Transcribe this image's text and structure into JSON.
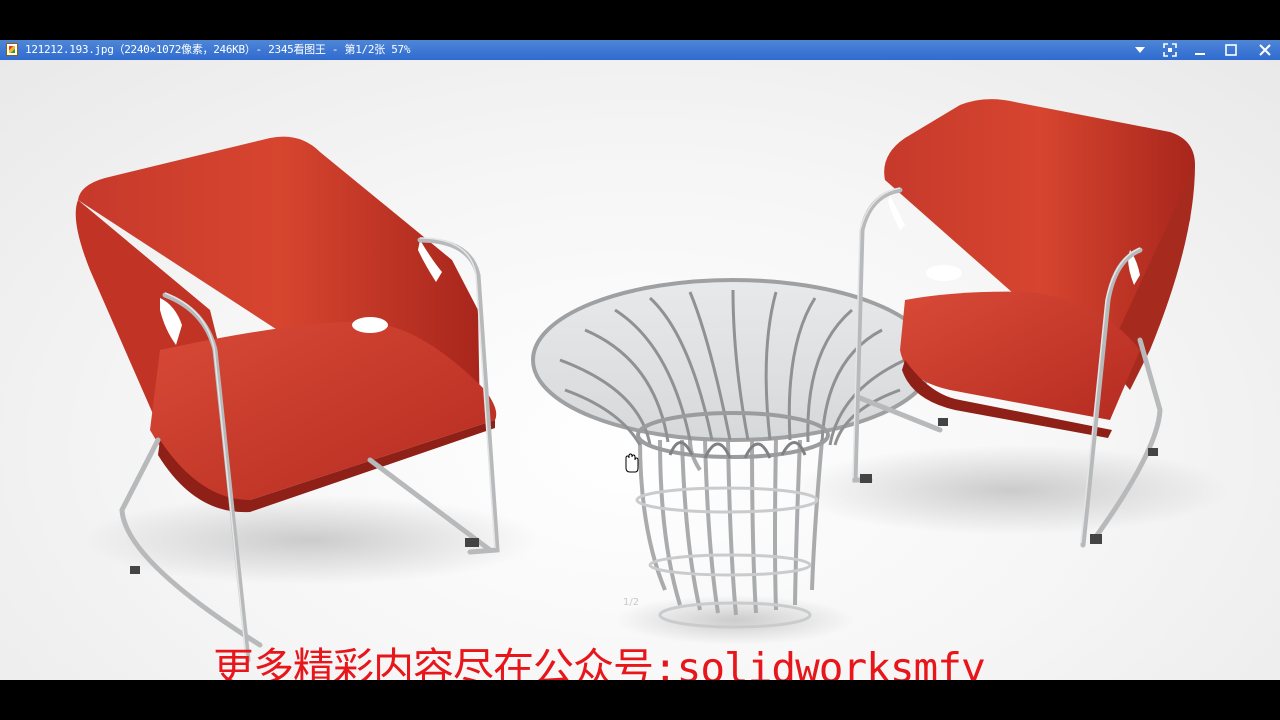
{
  "window": {
    "title": "121212.193.jpg（2240×1072像素，246KB）- 2345看图王 - 第1/2张 57%",
    "controls": [
      "chevron-down-icon",
      "fullscreen-icon",
      "minimize-icon",
      "maximize-icon",
      "close-icon"
    ]
  },
  "image": {
    "watermark_text": "更多精彩内容尽在公众号:solidworksmfy",
    "page_hint": "1/2",
    "watermark_color": "#e8161a",
    "chair_color": "#c9372a"
  }
}
